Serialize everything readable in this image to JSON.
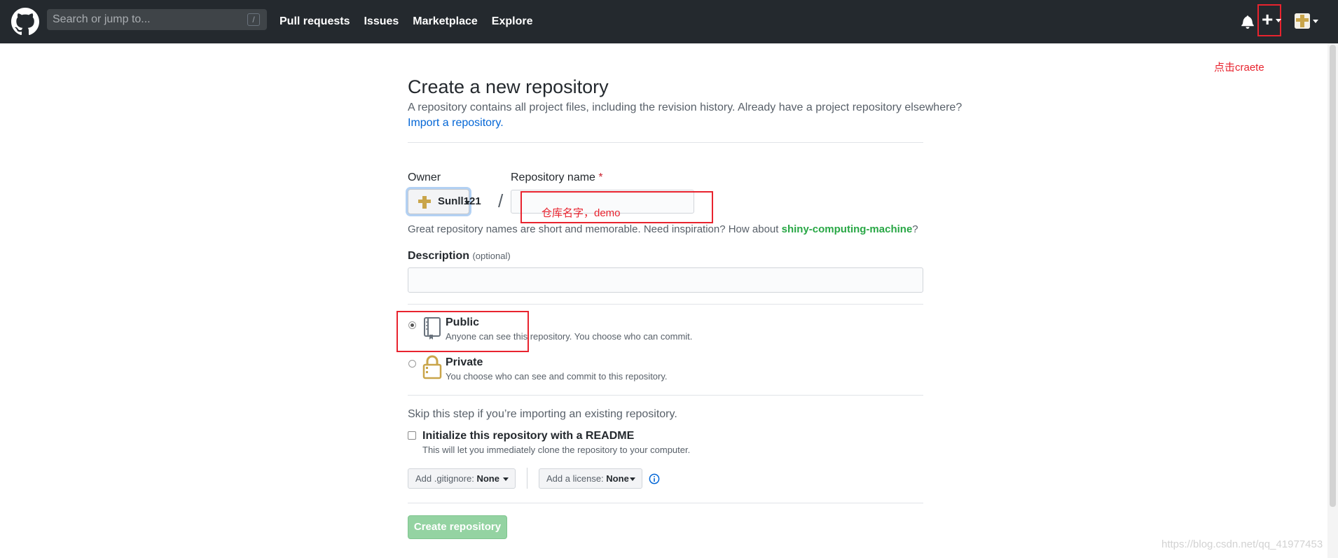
{
  "header": {
    "search_placeholder": "Search or jump to...",
    "search_shortcut": "/",
    "nav": [
      "Pull requests",
      "Issues",
      "Marketplace",
      "Explore"
    ]
  },
  "annotations": {
    "create_hint": "点击craete",
    "repo_name_hint": "仓库名字，demo"
  },
  "page": {
    "title": "Create a new repository",
    "subtitle": "A repository contains all project files, including the revision history. Already have a project repository elsewhere?",
    "import_link": "Import a repository."
  },
  "form": {
    "owner_label": "Owner",
    "owner_value": "Sunll121",
    "slash": "/",
    "repo_name_label": "Repository name",
    "required_mark": "*",
    "name_hint_prefix": "Great repository names are short and memorable. Need inspiration? How about ",
    "name_hint_suggestion": "shiny-computing-machine",
    "name_hint_suffix": "?",
    "description_label": "Description",
    "description_optional": "(optional)",
    "visibility": [
      {
        "title": "Public",
        "desc": "Anyone can see this repository. You choose who can commit.",
        "checked": true
      },
      {
        "title": "Private",
        "desc": "You choose who can see and commit to this repository.",
        "checked": false
      }
    ],
    "skip_text": "Skip this step if you’re importing an existing repository.",
    "readme_label": "Initialize this repository with a README",
    "readme_desc": "This will let you immediately clone the repository to your computer.",
    "gitignore_label": "Add .gitignore:",
    "gitignore_value": "None",
    "license_label": "Add a license:",
    "license_value": "None",
    "create_button": "Create repository"
  },
  "watermark": "https://blog.csdn.net/qq_41977453",
  "colors": {
    "header_bg": "#24292e",
    "annotation_red": "#e8232e",
    "link_blue": "#0366d6",
    "create_button_bg": "#94d3a2"
  }
}
